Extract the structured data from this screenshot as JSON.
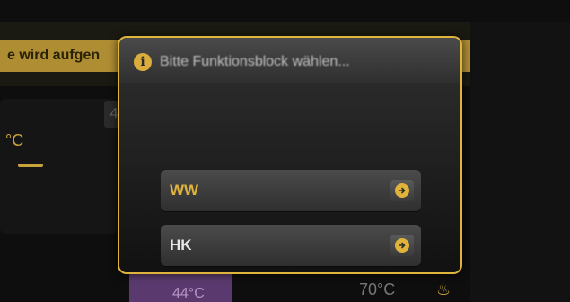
{
  "background": {
    "banner_text": "e wird aufgen",
    "left_temp": "°C",
    "mid_number": "4",
    "bottom_temp_left": "44°C",
    "bottom_temp_right": "70°C",
    "bottom_icon": "flame-heat-icon"
  },
  "dialog": {
    "title": "Bitte Funktionsblock wählen...",
    "info_icon": "info-icon",
    "options": [
      {
        "label": "WW",
        "arrow_icon": "arrow-right-circle-icon",
        "accent": "#e0b43a"
      },
      {
        "label": "HK",
        "arrow_icon": "arrow-right-circle-icon",
        "accent": "#e8e8e8"
      }
    ],
    "border_color": "#e0b43a"
  }
}
